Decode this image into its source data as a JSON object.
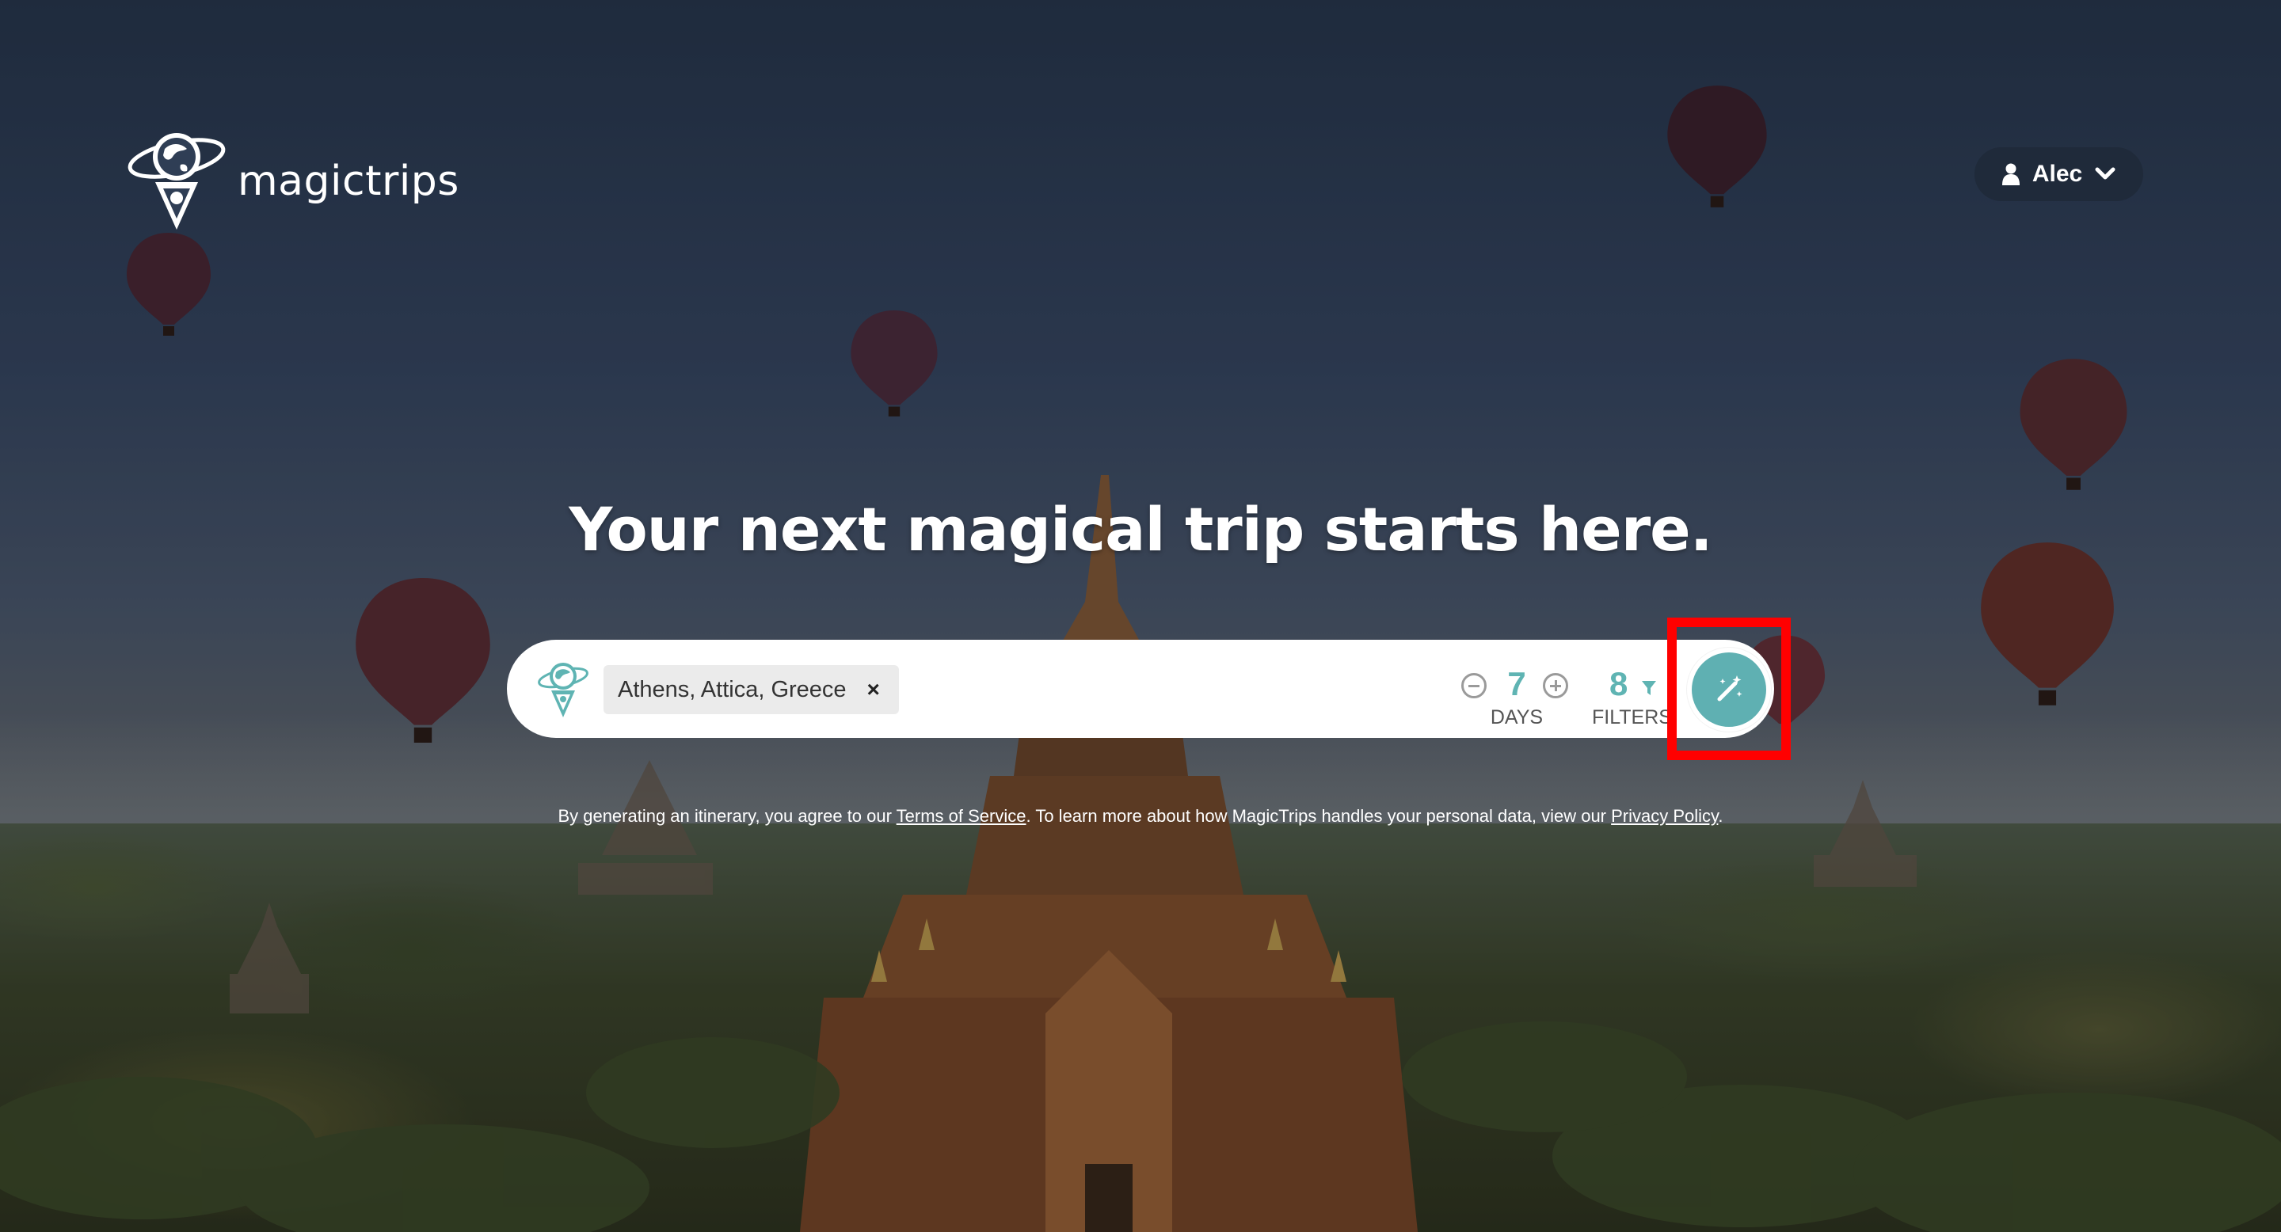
{
  "brand": {
    "name": "magictrips"
  },
  "user": {
    "name": "Alec"
  },
  "hero": {
    "headline": "Your next magical trip starts here."
  },
  "search": {
    "destination": "Athens, Attica, Greece",
    "remove_symbol": "×",
    "days_value": "7",
    "days_label": "DAYS",
    "filters_value": "8",
    "filters_label": "FILTERS"
  },
  "legal": {
    "prefix": "By generating an itinerary, you agree to our ",
    "terms_link": "Terms of Service",
    "middle": ". To learn more about how MagicTrips handles your personal data, view our ",
    "privacy_link": "Privacy Policy",
    "suffix": "."
  },
  "icons": {
    "logo": "globe-pin-logo-icon",
    "user": "user-icon",
    "dropdown": "chevron-down-icon",
    "destination": "globe-pin-icon",
    "decrement": "minus-circle-icon",
    "increment": "plus-circle-icon",
    "filter": "filter-icon",
    "generate": "magic-wand-icon"
  },
  "colors": {
    "accent": "#5fb4b3",
    "highlight": "#ff0000",
    "user_button_bg": "#1f2a3a"
  }
}
